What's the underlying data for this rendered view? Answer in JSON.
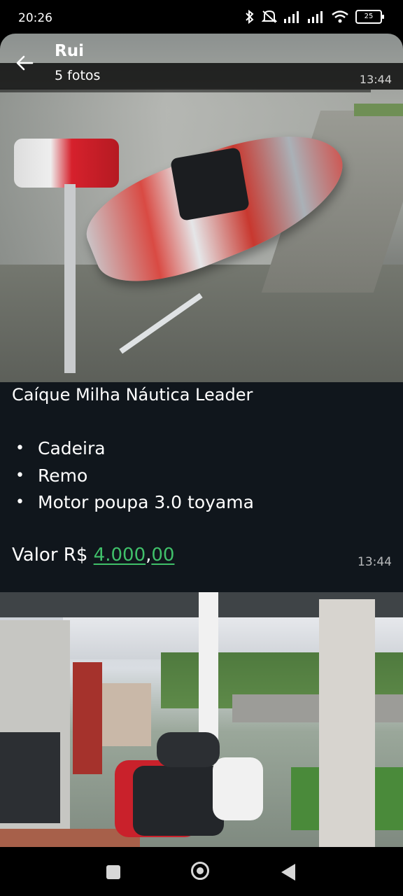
{
  "status_bar": {
    "time": "20:26",
    "battery": "25"
  },
  "header": {
    "contact_name": "Rui",
    "photo_count": "5 fotos",
    "time": "13:44"
  },
  "message": {
    "title": "Caíque Milha Náutica  Leader",
    "items": [
      "Cadeira",
      "Remo",
      "Motor poupa 3.0 toyama"
    ],
    "price_label": "Valor  R$ ",
    "price_value_int": "4.000",
    "price_sep": ",",
    "price_value_dec": "00",
    "time": "13:44"
  },
  "colors": {
    "link_green": "#40c06a",
    "message_bg": "#10161c"
  },
  "icons": [
    "bluetooth-icon",
    "mute-icon",
    "signal-icon",
    "signal-icon",
    "wifi-icon",
    "battery-icon",
    "back-arrow-icon",
    "recent-apps-icon",
    "home-icon",
    "back-icon"
  ]
}
